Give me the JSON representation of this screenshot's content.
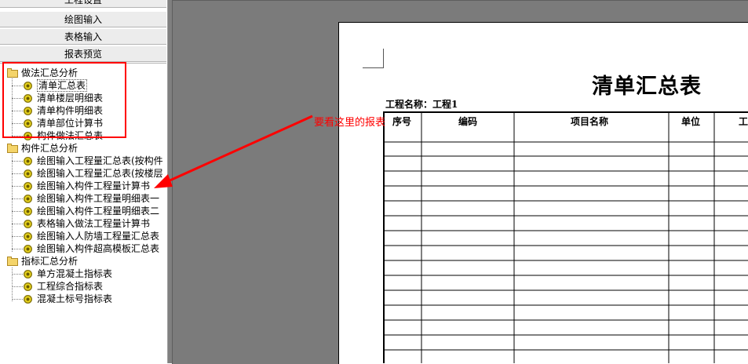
{
  "nav": {
    "project_settings": "工程设置",
    "drawing_input": "绘图输入",
    "table_input": "表格输入",
    "report_preview": "报表预览"
  },
  "tree": {
    "groups": [
      {
        "label": "做法汇总分析",
        "items": [
          "清单汇总表",
          "清单楼层明细表",
          "清单构件明细表",
          "清单部位计算书",
          "构件做法汇总表"
        ]
      },
      {
        "label": "构件汇总分析",
        "items": [
          "绘图输入工程量汇总表(按构件",
          "绘图输入工程量汇总表(按楼层",
          "绘图输入构件工程量计算书",
          "绘图输入构件工程量明细表一",
          "绘图输入构件工程量明细表二",
          "表格输入做法工程量计算书",
          "绘图输入人防墙工程量汇总表",
          "绘图输入构件超高模板汇总表"
        ]
      },
      {
        "label": "指标汇总分析",
        "items": [
          "单方混凝土指标表",
          "工程综合指标表",
          "混凝土标号指标表"
        ]
      }
    ]
  },
  "annotation": "要看这里的报表",
  "report": {
    "title": "清单汇总表",
    "project_name": "工程名称：工程1",
    "headers": [
      "序号",
      "编码",
      "项目名称",
      "单位",
      "工"
    ]
  },
  "colors": {
    "annotation_red": "#ff0000",
    "preview_gray": "#808080"
  }
}
